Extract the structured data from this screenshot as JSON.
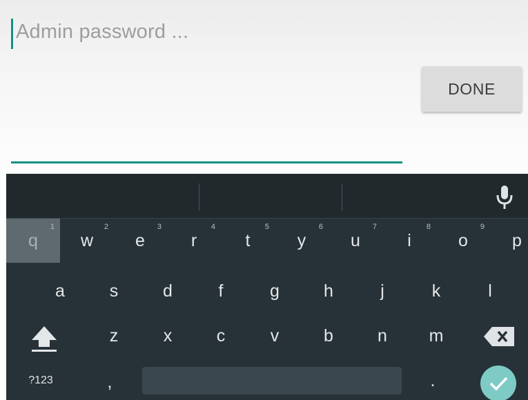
{
  "field": {
    "placeholder": "Admin password ...",
    "value": ""
  },
  "done_button": {
    "label": "DONE"
  },
  "keyboard": {
    "row1": [
      {
        "ch": "q",
        "hint": "1"
      },
      {
        "ch": "w",
        "hint": "2"
      },
      {
        "ch": "e",
        "hint": "3"
      },
      {
        "ch": "r",
        "hint": "4"
      },
      {
        "ch": "t",
        "hint": "5"
      },
      {
        "ch": "y",
        "hint": "6"
      },
      {
        "ch": "u",
        "hint": "7"
      },
      {
        "ch": "i",
        "hint": "8"
      },
      {
        "ch": "o",
        "hint": "9"
      },
      {
        "ch": "p",
        "hint": ""
      }
    ],
    "row2": [
      "a",
      "s",
      "d",
      "f",
      "g",
      "h",
      "j",
      "k",
      "l"
    ],
    "row3": [
      "z",
      "x",
      "c",
      "v",
      "b",
      "n",
      "m"
    ],
    "symbols_label": "?123",
    "comma_label": ",",
    "period_label": ".",
    "pressed_key": "q",
    "icons": {
      "mic": "mic-icon",
      "shift": "shift-icon",
      "backspace": "backspace-icon",
      "enter": "check-icon"
    }
  },
  "colors": {
    "accent": "#129083",
    "keyboard_bg": "#263238",
    "enter_bg": "#7dcbc4"
  }
}
